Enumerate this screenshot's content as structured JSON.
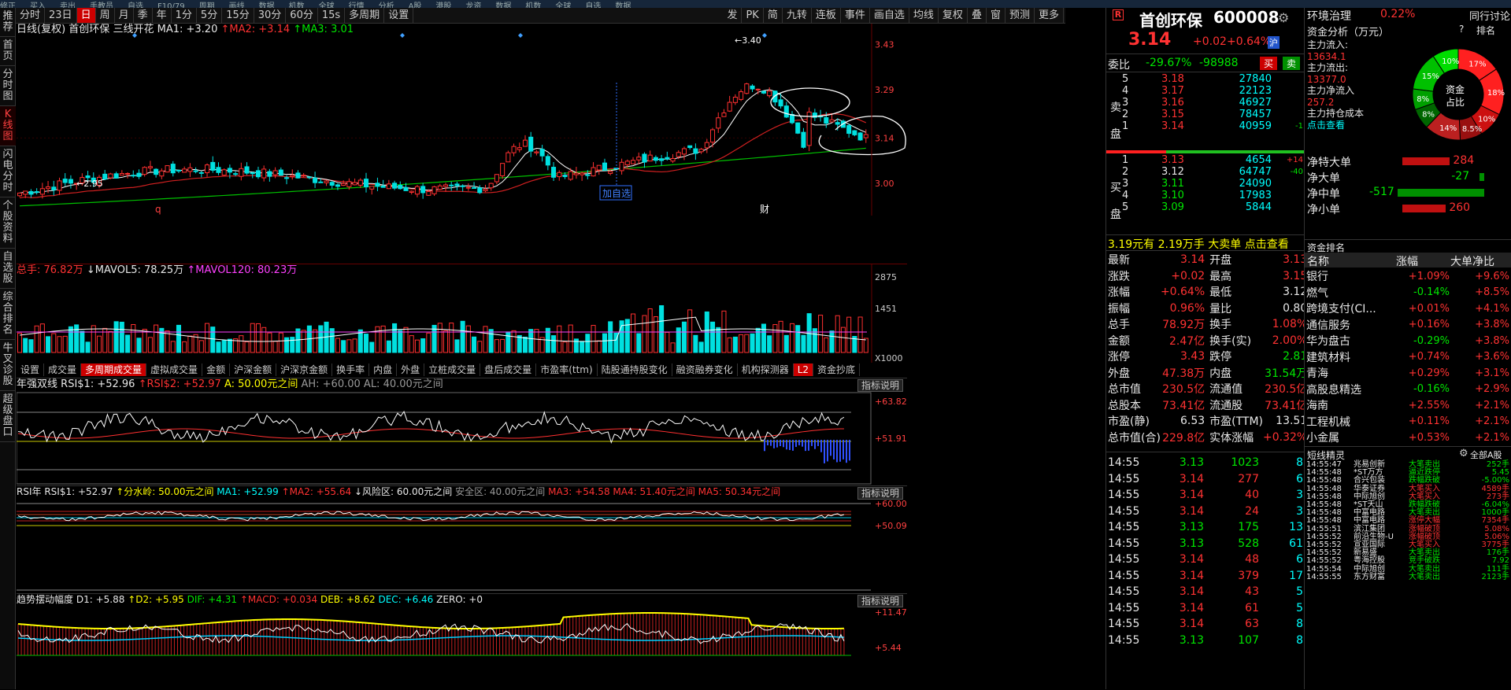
{
  "topbar": {
    "items": [
      "修正",
      "买入",
      "卖出",
      "手教员",
      "自选",
      "F10/79",
      "周期",
      "画线",
      "数据",
      "机数",
      "全球",
      "行情",
      "分析",
      "A股",
      "港股",
      "龙资",
      "数据",
      "机数",
      "全球",
      "自选",
      "数据"
    ]
  },
  "leftnav": {
    "items": [
      {
        "label": "推荐"
      },
      {
        "label": "首页"
      },
      {
        "label": "分时图"
      },
      {
        "label": "K线图",
        "active": true
      },
      {
        "label": "闪电分时"
      },
      {
        "label": "个股资料"
      },
      {
        "label": "自选股"
      },
      {
        "label": "综合排名"
      },
      {
        "label": "牛叉诊股"
      },
      {
        "label": "超级盘口"
      }
    ]
  },
  "toolbar": {
    "left": [
      "分时",
      "23日",
      "日",
      "周",
      "月",
      "季",
      "年",
      "1分",
      "5分",
      "15分",
      "30分",
      "60分",
      "15s",
      "多周期",
      "设置"
    ],
    "selected": "日",
    "right": [
      "发",
      "PK",
      "简",
      "九转",
      "连板",
      "事件",
      "画自选",
      "均线",
      "复权",
      "叠",
      "窗",
      "预测",
      "更多"
    ]
  },
  "kchart": {
    "title_prefix": "日线(复权)",
    "stock": "首创环保",
    "method": "三线开花",
    "ma1": "MA1: +3.20",
    "ma2": "MA2: +3.14",
    "ma3": "MA3: 3.01",
    "price_ticks": [
      "3.43",
      "3.29",
      "3.14",
      "3.00"
    ],
    "high_label": "3.40",
    "low_label": "2.95",
    "add_watch": "加自选",
    "marker_q": "q",
    "marker_cai": "财"
  },
  "volume": {
    "title": "总手: 76.82万",
    "mavol5": "MAVOL5: 78.25万",
    "mavol120": "MAVOL120: 80.23万",
    "ticks": [
      "2875",
      "1451",
      "X1000"
    ]
  },
  "indicator_tabs": [
    "设置",
    "成交量",
    "多周期成交量",
    "虚拟成交量",
    "金额",
    "沪深金额",
    "沪深京金额",
    "换手率",
    "内盘",
    "外盘",
    "立桩成交量",
    "盘后成交量",
    "市盈率(ttm)",
    "陆股通持股变化",
    "融资融券变化",
    "机构探测器",
    "L2",
    "资金抄底"
  ],
  "indicator_selected": "多周期成交量",
  "rsi1": {
    "title": "年强双线",
    "parts": [
      "RSI$1: +52.96",
      "RSI$2: +52.97",
      "A: 50.00元之间",
      "AH: +60.00",
      "AL: 40.00元之间"
    ],
    "ticks": [
      "+63.82",
      "+51.91"
    ],
    "btn": "指标说明"
  },
  "rsi2": {
    "title": "RSI年",
    "parts": [
      "RSI$1: +52.97",
      "分水岭: 50.00元之间",
      "MA1: +52.99",
      "MA2: +55.64",
      "风险区: 60.00元之间",
      "安全区: 40.00元之间",
      "MA3: +54.58",
      "MA4: 51.40元之间",
      "MA5: 50.34元之间"
    ],
    "ticks": [
      "+60.00",
      "+50.09"
    ],
    "btn": "指标说明"
  },
  "trend": {
    "title": "趋势摆动幅度",
    "parts": [
      "D1: +5.88",
      "D2: +5.95",
      "DIF: +4.31",
      "MACD: +0.034",
      "DEB: +8.62",
      "DEC: +6.46",
      "ZERO: +0"
    ],
    "ticks": [
      "+11.47",
      "+5.44"
    ],
    "btn": "指标说明"
  },
  "quote": {
    "r_icon": "R",
    "name": "首创环保",
    "code": "600008",
    "price": "3.14",
    "change": "+0.02",
    "pct": "+0.64%",
    "tag": "沪",
    "weibi_label": "委比",
    "weibi": "-29.67%",
    "weicha": "-98988",
    "buy_btn": "买",
    "sell_btn": "卖",
    "sell_side_label": "卖盘",
    "buy_side_label": "买盘",
    "asks": [
      {
        "lvl": "5",
        "price": "3.18",
        "vol": "27840",
        "chg": ""
      },
      {
        "lvl": "4",
        "price": "3.17",
        "vol": "22123",
        "chg": ""
      },
      {
        "lvl": "3",
        "price": "3.16",
        "vol": "46927",
        "chg": ""
      },
      {
        "lvl": "2",
        "price": "3.15",
        "vol": "78457",
        "chg": ""
      },
      {
        "lvl": "1",
        "price": "3.14",
        "vol": "40959",
        "chg": "-1"
      }
    ],
    "bids": [
      {
        "lvl": "1",
        "price": "3.13",
        "vol": "4654",
        "chg": "+14"
      },
      {
        "lvl": "2",
        "price": "3.12",
        "vol": "64747",
        "chg": "-40"
      },
      {
        "lvl": "3",
        "price": "3.11",
        "vol": "24090",
        "chg": ""
      },
      {
        "lvl": "4",
        "price": "3.10",
        "vol": "17983",
        "chg": ""
      },
      {
        "lvl": "5",
        "price": "3.09",
        "vol": "5844",
        "chg": ""
      }
    ],
    "bigorder": {
      "a": "3.19元有",
      "b": "2.19万手",
      "c": "大卖单",
      "d": "点击查看"
    },
    "stats": [
      [
        "最新",
        "3.14",
        "开盘",
        "3.13"
      ],
      [
        "涨跌",
        "+0.02",
        "最高",
        "3.15"
      ],
      [
        "涨幅",
        "+0.64%",
        "最低",
        "3.12"
      ],
      [
        "振幅",
        "0.96%",
        "量比",
        "0.80"
      ],
      [
        "总手",
        "78.92万",
        "换手",
        "1.08%"
      ],
      [
        "金额",
        "2.47亿",
        "换手(实)",
        "2.00%"
      ],
      [
        "涨停",
        "3.43",
        "跌停",
        "2.81"
      ],
      [
        "外盘",
        "47.38万",
        "内盘",
        "31.54万"
      ],
      [
        "总市值",
        "230.5亿",
        "流通值",
        "230.5亿"
      ],
      [
        "总股本",
        "73.41亿",
        "流通股",
        "73.41亿"
      ],
      [
        "市盈(静)",
        "6.53",
        "市盈(TTM)",
        "13.51"
      ],
      [
        "总市值(合)",
        "229.8亿",
        "实体涨幅",
        "+0.32%"
      ]
    ],
    "ticks": [
      [
        "14:55",
        "3.13",
        "1023",
        "8"
      ],
      [
        "14:55",
        "3.14",
        "277",
        "6"
      ],
      [
        "14:55",
        "3.14",
        "40",
        "3"
      ],
      [
        "14:55",
        "3.14",
        "24",
        "3"
      ],
      [
        "14:55",
        "3.13",
        "175",
        "13"
      ],
      [
        "14:55",
        "3.13",
        "528",
        "61"
      ],
      [
        "14:55",
        "3.14",
        "48",
        "6"
      ],
      [
        "14:55",
        "3.14",
        "379",
        "17"
      ],
      [
        "14:55",
        "3.14",
        "43",
        "5"
      ],
      [
        "14:55",
        "3.14",
        "61",
        "5"
      ],
      [
        "14:55",
        "3.14",
        "63",
        "8"
      ],
      [
        "14:55",
        "3.13",
        "107",
        "8"
      ]
    ]
  },
  "fund": {
    "sector": "环境治理",
    "sector_pct": "0.22%",
    "next": "同行讨论",
    "title": "资金分析（万元）",
    "help": "?",
    "rank": "排名",
    "lines": [
      "主力流入:",
      "13634.1",
      "主力流出:",
      "13377.0",
      "主力净流入",
      "257.2",
      "主力持仓成本",
      "点击查看"
    ],
    "donut_center": "资金占比",
    "donut": [
      {
        "label": "17%",
        "color": "#ff2020",
        "value": 17
      },
      {
        "label": "18%",
        "color": "#ff2020",
        "value": 18
      },
      {
        "label": "10%",
        "color": "#cc1010",
        "value": 10
      },
      {
        "label": "8.5%",
        "color": "#991010",
        "value": 8.5
      },
      {
        "label": "14%",
        "color": "#bb2020",
        "value": 14
      },
      {
        "label": "8%",
        "color": "#006600",
        "value": 8
      },
      {
        "label": "8%",
        "color": "#00a000",
        "value": 8
      },
      {
        "label": "15%",
        "color": "#00c000",
        "value": 15
      },
      {
        "label": "10%",
        "color": "#00dd00",
        "value": 10
      }
    ],
    "net": [
      {
        "label": "净特大单",
        "value": "284",
        "num": 284
      },
      {
        "label": "净大单",
        "value": "-27",
        "num": -27
      },
      {
        "label": "净中单",
        "value": "-517",
        "num": -517
      },
      {
        "label": "净小单",
        "value": "260",
        "num": 260
      }
    ]
  },
  "sector_rank": {
    "title": "资金排名",
    "headers": [
      "名称",
      "涨幅",
      "大单净比"
    ],
    "rows": [
      [
        "银行",
        "+1.09%",
        "+9.6%"
      ],
      [
        "燃气",
        "-0.14%",
        "+8.5%"
      ],
      [
        "跨境支付(CI...",
        "+0.01%",
        "+4.1%"
      ],
      [
        "通信服务",
        "+0.16%",
        "+3.8%"
      ],
      [
        "华为盘古",
        "-0.29%",
        "+3.8%"
      ],
      [
        "建筑材料",
        "+0.74%",
        "+3.6%"
      ],
      [
        "青海",
        "+0.29%",
        "+3.1%"
      ],
      [
        "高股息精选",
        "-0.16%",
        "+2.9%"
      ],
      [
        "海南",
        "+2.55%",
        "+2.1%"
      ],
      [
        "工程机械",
        "+0.11%",
        "+2.1%"
      ],
      [
        "小金属",
        "+0.53%",
        "+2.1%"
      ]
    ]
  },
  "flash": {
    "title": "短线精灵",
    "filter": "全部A股",
    "rows": [
      [
        "14:55:47",
        "兆易创新",
        "大笔卖出",
        "252手"
      ],
      [
        "14:55:48",
        "*ST万方",
        "逼近跌停",
        "5.45"
      ],
      [
        "14:55:48",
        "合兴包装",
        "跌幅跌破",
        "-5.00%"
      ],
      [
        "14:55:48",
        "华泰证券",
        "大笔买入",
        "4589手"
      ],
      [
        "14:55:48",
        "中际旭创",
        "大笔买入",
        "273手"
      ],
      [
        "14:55:48",
        "*ST天山",
        "跌幅跌破",
        "-6.04%"
      ],
      [
        "14:55:48",
        "中富电路",
        "大笔卖出",
        "1000手"
      ],
      [
        "14:55:48",
        "中富电路",
        "涨停大幅",
        "7354手"
      ],
      [
        "14:55:51",
        "滨江集团",
        "涨幅破顶",
        "5.08%"
      ],
      [
        "14:55:52",
        "前沿生物-U",
        "涨幅破顶",
        "5.06%"
      ],
      [
        "14:55:52",
        "宣亚国际",
        "大笔买入",
        "3775手"
      ],
      [
        "14:55:52",
        "新易盛",
        "大笔卖出",
        "176手"
      ],
      [
        "14:55:52",
        "粤海控股",
        "竞手破跌",
        "7.92"
      ],
      [
        "14:55:54",
        "中际旭创",
        "大笔卖出",
        "111手"
      ],
      [
        "14:55:55",
        "东方财富",
        "大笔卖出",
        "2123手"
      ]
    ]
  }
}
